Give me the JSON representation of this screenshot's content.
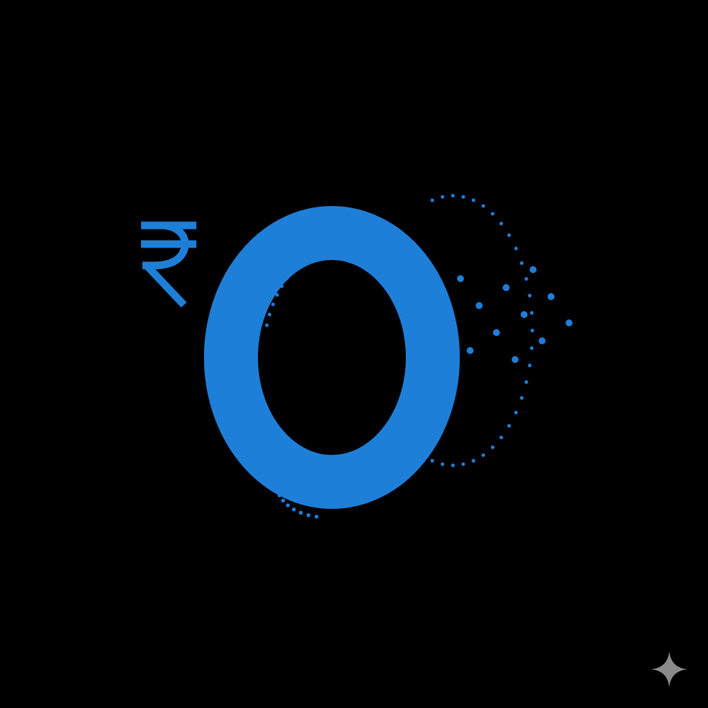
{
  "logo": {
    "glyph": "₹0",
    "currency_symbol": "₹",
    "digit": "0",
    "accent_color": "#1E7FD8",
    "background_color": "#000000",
    "particle_color": "#1E7FD8"
  },
  "watermark": {
    "icon": "sparkle-icon",
    "color": "#8A8A8A"
  }
}
